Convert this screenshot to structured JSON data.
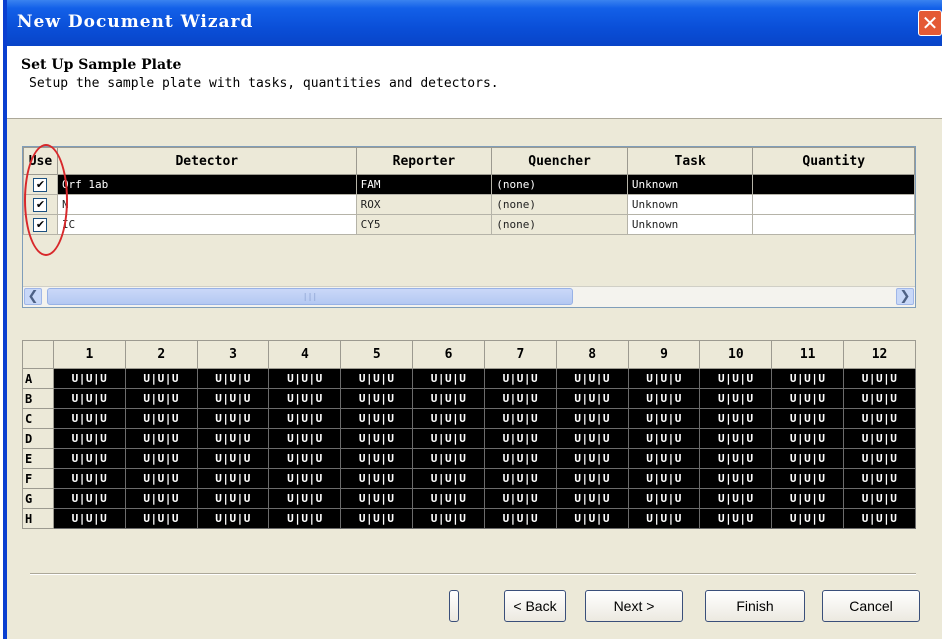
{
  "window": {
    "title": "New Document Wizard"
  },
  "header": {
    "title": "Set Up Sample Plate",
    "subtitle": "Setup the sample plate with tasks, quantities and detectors."
  },
  "detectors": {
    "columns": [
      "Use",
      "Detector",
      "Reporter",
      "Quencher",
      "Task",
      "Quantity"
    ],
    "rows": [
      {
        "use": true,
        "detector": "Orf 1ab",
        "reporter": "FAM",
        "quencher": "(none)",
        "task": "Unknown",
        "quantity": "",
        "selected": true
      },
      {
        "use": true,
        "detector": "N",
        "reporter": "ROX",
        "quencher": "(none)",
        "task": "Unknown",
        "quantity": "",
        "selected": false
      },
      {
        "use": true,
        "detector": "IC",
        "reporter": "CY5",
        "quencher": "(none)",
        "task": "Unknown",
        "quantity": "",
        "selected": false
      }
    ]
  },
  "plate": {
    "columns": [
      "1",
      "2",
      "3",
      "4",
      "5",
      "6",
      "7",
      "8",
      "9",
      "10",
      "11",
      "12"
    ],
    "rows": [
      "A",
      "B",
      "C",
      "D",
      "E",
      "F",
      "G",
      "H"
    ],
    "well_text": "U|U|U"
  },
  "buttons": {
    "back": "< Back",
    "next": "Next >",
    "finish": "Finish",
    "cancel": "Cancel",
    "close_glyph": "✕",
    "check_glyph": "✔"
  },
  "colors": {
    "title_bar": "#0a4fd8",
    "selected_row": "#000000",
    "well_fill": "#000000",
    "annotation_oval": "#d8282b"
  }
}
